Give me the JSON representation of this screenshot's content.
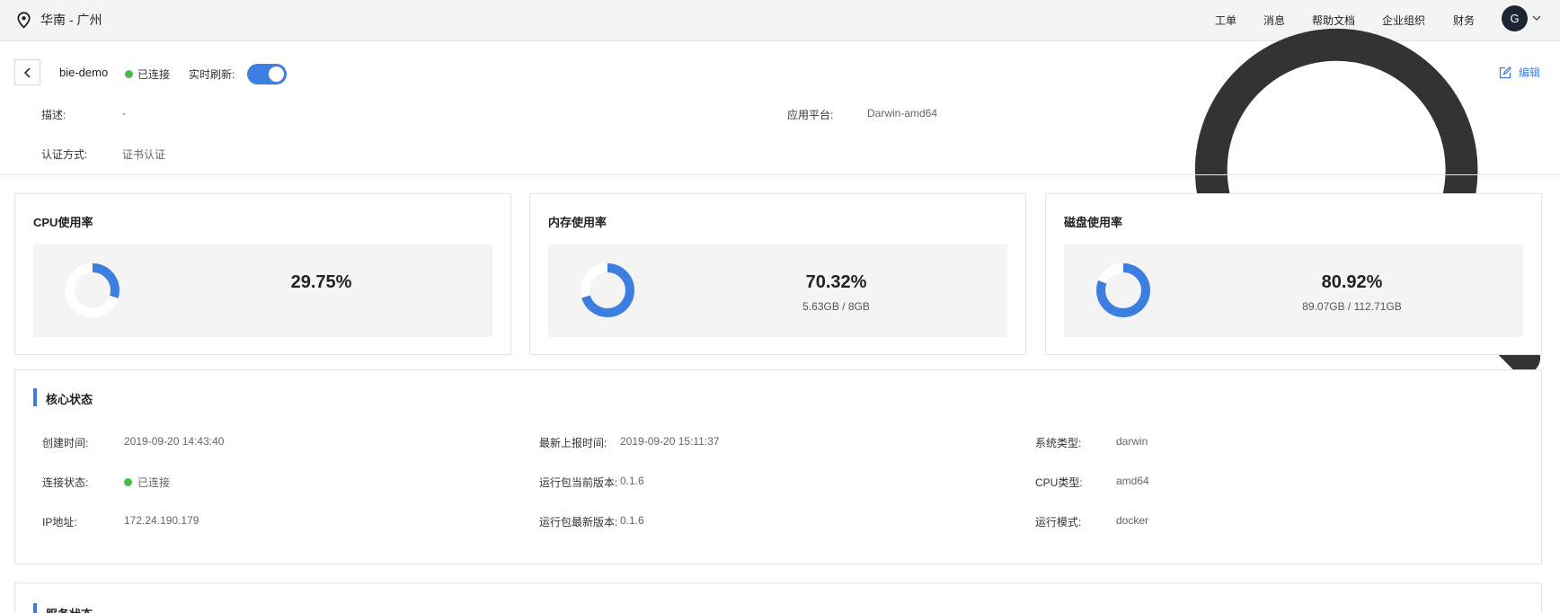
{
  "topbar": {
    "region": "华南 - 广州",
    "nav": [
      "工单",
      "消息",
      "帮助文档",
      "企业组织",
      "财务"
    ],
    "avatar_letter": "G"
  },
  "header": {
    "name": "bie-demo",
    "status": "已连接",
    "realtime_label": "实时刷新:",
    "realtime_on": true,
    "edit_label": "编辑",
    "desc_label": "描述:",
    "desc_value": "-",
    "platform_label": "应用平台:",
    "platform_value": "Darwin-amd64",
    "auth_label": "认证方式:",
    "auth_value": "证书认证"
  },
  "usage": [
    {
      "title": "CPU使用率",
      "percent": 29.75,
      "percent_text": "29.75%",
      "detail": ""
    },
    {
      "title": "内存使用率",
      "percent": 70.32,
      "percent_text": "70.32%",
      "detail": "5.63GB / 8GB"
    },
    {
      "title": "磁盘使用率",
      "percent": 80.92,
      "percent_text": "80.92%",
      "detail": "89.07GB / 112.71GB"
    }
  ],
  "core": {
    "title": "核心状态",
    "rows": [
      [
        {
          "label": "创建时间:",
          "value": "2019-09-20 14:43:40"
        },
        {
          "label": "最新上报时间:",
          "value": "2019-09-20 15:11:37"
        },
        {
          "label": "系统类型:",
          "value": "darwin"
        }
      ],
      [
        {
          "label": "连接状态:",
          "value": "已连接"
        },
        {
          "label": "运行包当前版本:",
          "value": "0.1.6"
        },
        {
          "label": "CPU类型:",
          "value": "amd64"
        }
      ],
      [
        {
          "label": "IP地址:",
          "value": "172.24.190.179"
        },
        {
          "label": "运行包最新版本:",
          "value": "0.1.6"
        },
        {
          "label": "运行模式:",
          "value": "docker"
        }
      ]
    ]
  },
  "service": {
    "title": "服务状态"
  },
  "colors": {
    "accent": "#3d7fe0",
    "ok": "#4cbb4a",
    "ring_bg": "#ffffff"
  }
}
